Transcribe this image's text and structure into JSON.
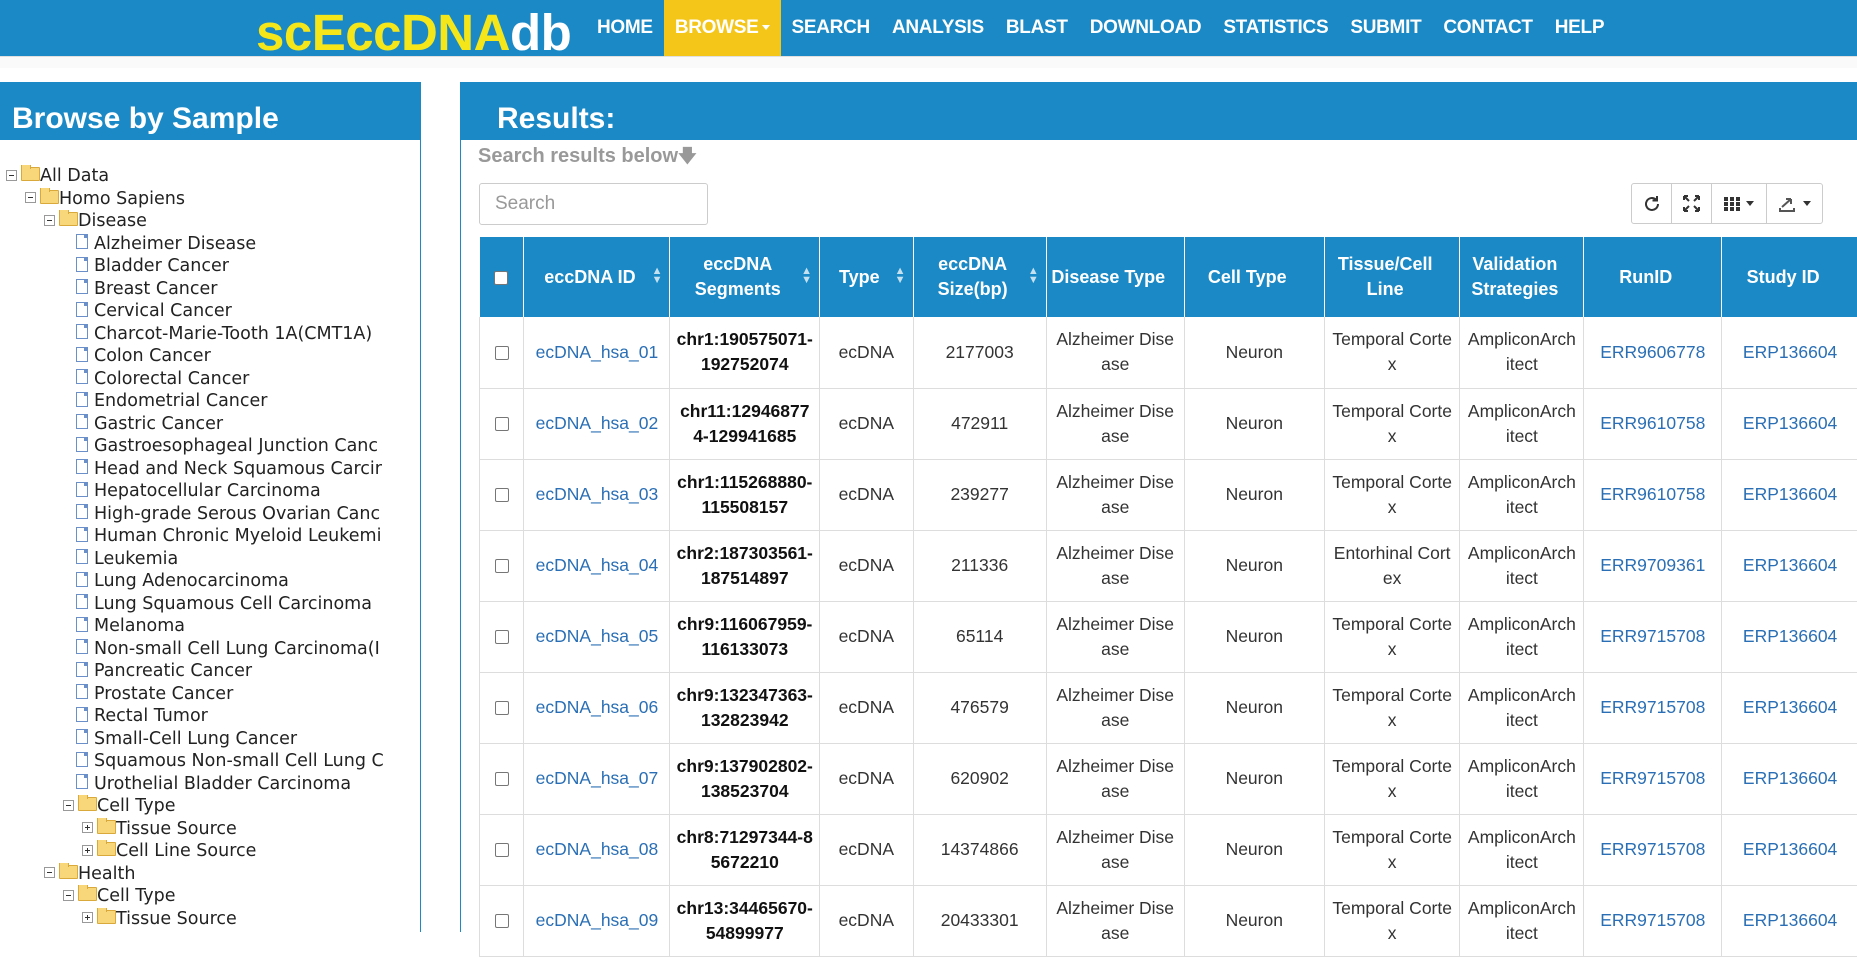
{
  "brand": {
    "part1": "scEccDNA",
    "part2": "db"
  },
  "nav": [
    {
      "label": "HOME",
      "active": false
    },
    {
      "label": "BROWSE",
      "active": true
    },
    {
      "label": "SEARCH",
      "active": false
    },
    {
      "label": "ANALYSIS",
      "active": false
    },
    {
      "label": "BLAST",
      "active": false
    },
    {
      "label": "DOWNLOAD",
      "active": false
    },
    {
      "label": "STATISTICS",
      "active": false
    },
    {
      "label": "SUBMIT",
      "active": false
    },
    {
      "label": "CONTACT",
      "active": false
    },
    {
      "label": "HELP",
      "active": false
    }
  ],
  "left": {
    "title": "Browse by Sample",
    "tree": [
      {
        "label": "All Data",
        "type": "folder",
        "exp": "minus",
        "level": 0
      },
      {
        "label": "Homo Sapiens",
        "type": "folder",
        "exp": "minus",
        "level": 1
      },
      {
        "label": "Disease",
        "type": "folder",
        "exp": "minus",
        "level": 2
      },
      {
        "label": "Alzheimer Disease",
        "type": "doc",
        "level": 3
      },
      {
        "label": "Bladder Cancer",
        "type": "doc",
        "level": 3
      },
      {
        "label": "Breast Cancer",
        "type": "doc",
        "level": 3
      },
      {
        "label": "Cervical Cancer",
        "type": "doc",
        "level": 3
      },
      {
        "label": "Charcot-Marie-Tooth 1A(CMT1A)",
        "type": "doc",
        "level": 3
      },
      {
        "label": "Colon Cancer",
        "type": "doc",
        "level": 3
      },
      {
        "label": "Colorectal Cancer",
        "type": "doc",
        "level": 3
      },
      {
        "label": "Endometrial Cancer",
        "type": "doc",
        "level": 3
      },
      {
        "label": "Gastric Cancer",
        "type": "doc",
        "level": 3
      },
      {
        "label": "Gastroesophageal Junction Canc",
        "type": "doc",
        "level": 3
      },
      {
        "label": "Head and Neck Squamous Carcir",
        "type": "doc",
        "level": 3
      },
      {
        "label": "Hepatocellular Carcinoma",
        "type": "doc",
        "level": 3
      },
      {
        "label": "High-grade Serous Ovarian Canc",
        "type": "doc",
        "level": 3
      },
      {
        "label": "Human Chronic Myeloid Leukemi",
        "type": "doc",
        "level": 3
      },
      {
        "label": "Leukemia",
        "type": "doc",
        "level": 3
      },
      {
        "label": "Lung Adenocarcinoma",
        "type": "doc",
        "level": 3
      },
      {
        "label": "Lung Squamous Cell Carcinoma",
        "type": "doc",
        "level": 3
      },
      {
        "label": "Melanoma",
        "type": "doc",
        "level": 3
      },
      {
        "label": "Non-small Cell Lung Carcinoma(I",
        "type": "doc",
        "level": 3
      },
      {
        "label": "Pancreatic Cancer",
        "type": "doc",
        "level": 3
      },
      {
        "label": "Prostate Cancer",
        "type": "doc",
        "level": 3
      },
      {
        "label": "Rectal Tumor",
        "type": "doc",
        "level": 3
      },
      {
        "label": "Small-Cell Lung Cancer",
        "type": "doc",
        "level": 3
      },
      {
        "label": "Squamous Non-small Cell Lung C",
        "type": "doc",
        "level": 3
      },
      {
        "label": "Urothelial Bladder Carcinoma",
        "type": "doc",
        "level": 3
      },
      {
        "label": "Cell Type",
        "type": "folder",
        "exp": "minus",
        "level": 3
      },
      {
        "label": "Tissue Source",
        "type": "folder",
        "exp": "plus",
        "level": 4
      },
      {
        "label": "Cell Line Source",
        "type": "folder",
        "exp": "plus",
        "level": 4
      },
      {
        "label": "Health",
        "type": "folder",
        "exp": "minus",
        "level": 2
      },
      {
        "label": "Cell Type",
        "type": "folder",
        "exp": "minus",
        "level": 3
      },
      {
        "label": "Tissue Source",
        "type": "folder",
        "exp": "plus",
        "level": 4
      }
    ]
  },
  "results": {
    "title": "Results:",
    "hint": "Search results below",
    "search_placeholder": "Search",
    "columns": [
      "eccDNA ID",
      "eccDNA Segments",
      "Type",
      "eccDNA Size(bp)",
      "Disease Type",
      "Cell Type",
      "Tissue/Cell Line",
      "Validation Strategies",
      "RunID",
      "Study ID"
    ],
    "rows": [
      [
        "ecDNA_hsa_01",
        "chr1:190575071-192752074",
        "ecDNA",
        "2177003",
        "Alzheimer Disease",
        "Neuron",
        "Temporal Cortex",
        "AmpliconArchitect",
        "ERR9606778",
        "ERP136604"
      ],
      [
        "ecDNA_hsa_02",
        "chr11:129468774-129941685",
        "ecDNA",
        "472911",
        "Alzheimer Disease",
        "Neuron",
        "Temporal Cortex",
        "AmpliconArchitect",
        "ERR9610758",
        "ERP136604"
      ],
      [
        "ecDNA_hsa_03",
        "chr1:115268880-115508157",
        "ecDNA",
        "239277",
        "Alzheimer Disease",
        "Neuron",
        "Temporal Cortex",
        "AmpliconArchitect",
        "ERR9610758",
        "ERP136604"
      ],
      [
        "ecDNA_hsa_04",
        "chr2:187303561-187514897",
        "ecDNA",
        "211336",
        "Alzheimer Disease",
        "Neuron",
        "Entorhinal Cortex",
        "AmpliconArchitect",
        "ERR9709361",
        "ERP136604"
      ],
      [
        "ecDNA_hsa_05",
        "chr9:116067959-116133073",
        "ecDNA",
        "65114",
        "Alzheimer Disease",
        "Neuron",
        "Temporal Cortex",
        "AmpliconArchitect",
        "ERR9715708",
        "ERP136604"
      ],
      [
        "ecDNA_hsa_06",
        "chr9:132347363-132823942",
        "ecDNA",
        "476579",
        "Alzheimer Disease",
        "Neuron",
        "Temporal Cortex",
        "AmpliconArchitect",
        "ERR9715708",
        "ERP136604"
      ],
      [
        "ecDNA_hsa_07",
        "chr9:137902802-138523704",
        "ecDNA",
        "620902",
        "Alzheimer Disease",
        "Neuron",
        "Temporal Cortex",
        "AmpliconArchitect",
        "ERR9715708",
        "ERP136604"
      ],
      [
        "ecDNA_hsa_08",
        "chr8:71297344-85672210",
        "ecDNA",
        "14374866",
        "Alzheimer Disease",
        "Neuron",
        "Temporal Cortex",
        "AmpliconArchitect",
        "ERR9715708",
        "ERP136604"
      ],
      [
        "ecDNA_hsa_09",
        "chr13:34465670-54899977",
        "ecDNA",
        "20433301",
        "Alzheimer Disease",
        "Neuron",
        "Temporal Cortex",
        "AmpliconArchitect",
        "ERR9715708",
        "ERP136604"
      ]
    ]
  },
  "icons": [
    "refresh-icon",
    "fullscreen-icon",
    "columns-icon",
    "export-icon"
  ]
}
